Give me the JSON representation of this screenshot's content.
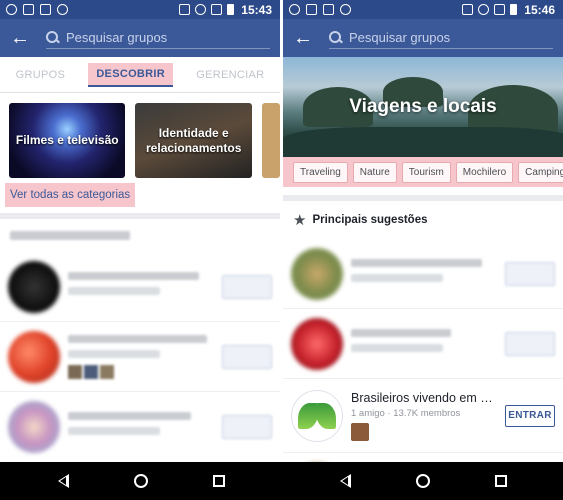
{
  "status_left": {
    "time": "15:43"
  },
  "status_right": {
    "time": "15:46"
  },
  "search": {
    "placeholder": "Pesquisar grupos"
  },
  "tabs": [
    {
      "label": "GRUPOS"
    },
    {
      "label": "DESCOBRIR"
    },
    {
      "label": "GERENCIAR"
    }
  ],
  "categories": [
    {
      "label": "Filmes e televisão"
    },
    {
      "label": "Identidade e relacionamentos"
    }
  ],
  "see_all_label": "Ver todas as categorias",
  "category_page": {
    "title": "Viagens e locais",
    "chips": [
      "Traveling",
      "Nature",
      "Tourism",
      "Mochilero",
      "Camping"
    ],
    "section_title": "Principais sugestões",
    "featured_group": {
      "name": "Brasileiros vivendo em …",
      "meta": "1 amigo · 13.7K membros",
      "join_label": "ENTRAR"
    }
  },
  "colors": {
    "appbar": "#3b5998",
    "statusbar": "#2c4a8a",
    "highlight": "#f7c6cc"
  }
}
